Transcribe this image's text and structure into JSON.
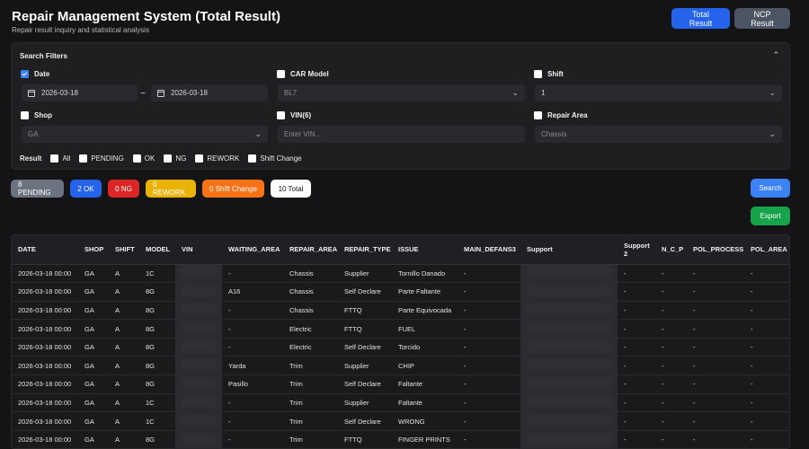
{
  "header": {
    "title": "Repair Management System (Total Result)",
    "subtitle": "Repair result inquiry and statistical analysis",
    "total_result_btn": "Total Result",
    "ncp_result_btn": "NCP Result"
  },
  "filters": {
    "title": "Search Filters",
    "date": {
      "label": "Date",
      "checked": true,
      "from": "2026-03-18",
      "to": "2026-03-18",
      "separator": "~"
    },
    "car_model": {
      "label": "CAR Model",
      "value": "BL7"
    },
    "shift": {
      "label": "Shift",
      "value": "1"
    },
    "shop": {
      "label": "Shop",
      "value": "GA"
    },
    "vin": {
      "label": "VIN(6)",
      "placeholder": "Enter VIN..."
    },
    "repair_area": {
      "label": "Repair Area",
      "value": "Chassis"
    },
    "result": {
      "label": "Result",
      "options": [
        "All",
        "PENDING",
        "OK",
        "NG",
        "REWORK",
        "Shift Change"
      ]
    }
  },
  "summary": {
    "pending": "8 PENDING",
    "ok": "2 OK",
    "ng": "0 NG",
    "rework": "0 REWORK",
    "shift_change": "0 Shift Change",
    "total": "10 Total"
  },
  "actions": {
    "search": "Search",
    "export": "Export"
  },
  "colors": {
    "primary": "#2563eb",
    "pending": "#6b7280",
    "ng": "#dc2626",
    "rework": "#eab308",
    "shift_change": "#f97316",
    "export": "#16a34a"
  },
  "table": {
    "columns": [
      "DATE",
      "SHOP",
      "SHIFT",
      "MODEL",
      "VIN",
      "WAITING_AREA",
      "REPAIR_AREA",
      "REPAIR_TYPE",
      "ISSUE",
      "MAIN_DEFANS3",
      "Support",
      "Support 2",
      "N_C_P",
      "POL_PROCESS",
      "POL_AREA"
    ],
    "rows": [
      [
        "2026-03-18 00:00",
        "GA",
        "A",
        "1C",
        "",
        "-",
        "Chassis",
        "Supplier",
        "Tornillo Danado",
        "-",
        "",
        "-",
        "-",
        "-",
        "-"
      ],
      [
        "2026-03-18 00:00",
        "GA",
        "A",
        "8G",
        "",
        "A16",
        "Chassis",
        "Self Declare",
        "Parte Faltante",
        "-",
        "",
        "-",
        "-",
        "-",
        "-"
      ],
      [
        "2026-03-18 00:00",
        "GA",
        "A",
        "8G",
        "",
        "-",
        "Chassis",
        "FTTQ",
        "Parte Equivocada",
        "-",
        "",
        "-",
        "-",
        "-",
        "-"
      ],
      [
        "2026-03-18 00:00",
        "GA",
        "A",
        "8G",
        "",
        "-",
        "Electric",
        "FTTQ",
        "FUEL",
        "-",
        "",
        "-",
        "-",
        "-",
        "-"
      ],
      [
        "2026-03-18 00:00",
        "GA",
        "A",
        "8G",
        "",
        "-",
        "Electric",
        "Self Declare",
        "Torcido",
        "-",
        "",
        "-",
        "-",
        "-",
        "-"
      ],
      [
        "2026-03-18 00:00",
        "GA",
        "A",
        "8G",
        "",
        "Yarda",
        "Trim",
        "Supplier",
        "CHIP",
        "-",
        "",
        "-",
        "-",
        "-",
        "-"
      ],
      [
        "2026-03-18 00:00",
        "GA",
        "A",
        "8G",
        "",
        "Pasillo",
        "Trim",
        "Self Declare",
        "Faltante",
        "-",
        "",
        "-",
        "-",
        "-",
        "-"
      ],
      [
        "2026-03-18 00:00",
        "GA",
        "A",
        "1C",
        "",
        "-",
        "Trim",
        "Supplier",
        "Faltante",
        "-",
        "",
        "-",
        "-",
        "-",
        "-"
      ],
      [
        "2026-03-18 00:00",
        "GA",
        "A",
        "1C",
        "",
        "-",
        "Trim",
        "Self Declare",
        "WRONG",
        "-",
        "",
        "-",
        "-",
        "-",
        "-"
      ],
      [
        "2026-03-18 00:00",
        "GA",
        "A",
        "8G",
        "",
        "-",
        "Trim",
        "FTTQ",
        "FINGER PRINTS",
        "-",
        "",
        "-",
        "-",
        "-",
        "-"
      ]
    ]
  }
}
